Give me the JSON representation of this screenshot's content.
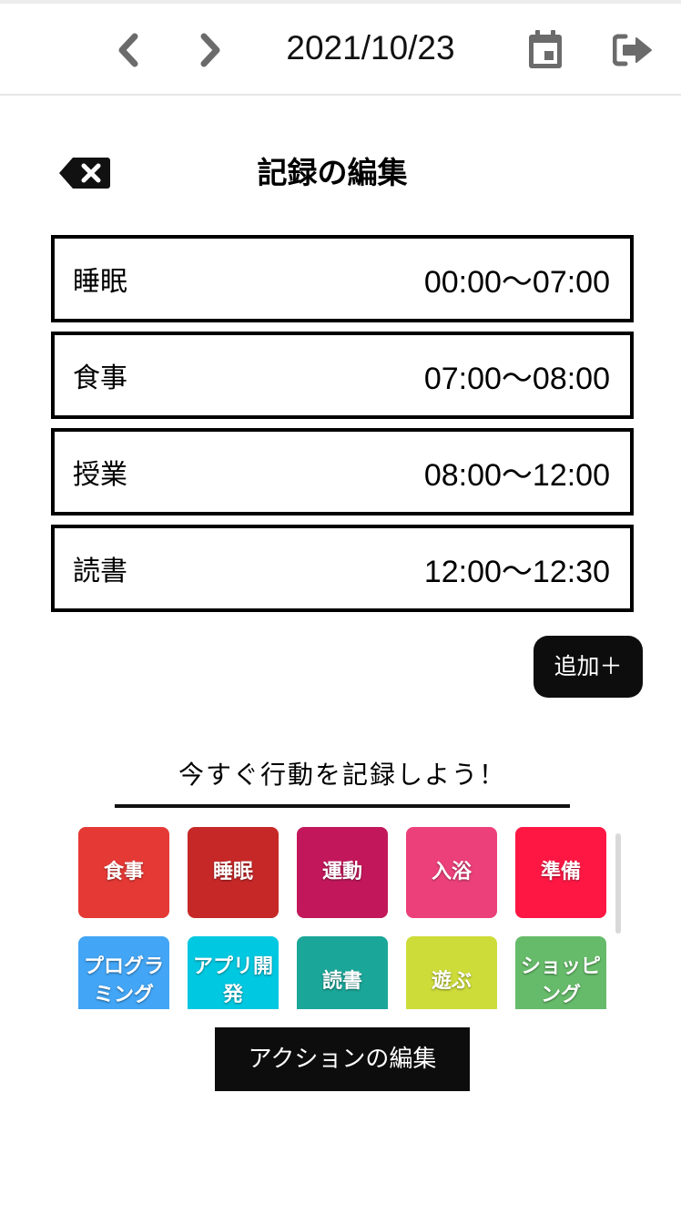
{
  "header": {
    "date": "2021/10/23",
    "prev_icon": "chevron-left-icon",
    "next_icon": "chevron-right-icon",
    "calendar_icon": "calendar-icon",
    "logout_icon": "logout-icon",
    "icon_color": "#6b6b6b"
  },
  "editor": {
    "title": "記録の編集",
    "back_icon": "backspace-icon"
  },
  "records": [
    {
      "name": "睡眠",
      "time": "00:00〜07:00"
    },
    {
      "name": "食事",
      "time": "07:00〜08:00"
    },
    {
      "name": "授業",
      "time": "08:00〜12:00"
    },
    {
      "name": "読書",
      "time": "12:00〜12:30"
    }
  ],
  "add_button": "追加＋",
  "quick": {
    "heading": "今すぐ行動を記録しよう！",
    "actions": [
      {
        "label": "食事",
        "color": "#e53935"
      },
      {
        "label": "睡眠",
        "color": "#c62828"
      },
      {
        "label": "運動",
        "color": "#c2185b"
      },
      {
        "label": "入浴",
        "color": "#ec407a"
      },
      {
        "label": "準備",
        "color": "#ff1744"
      },
      {
        "label": "プログラミング",
        "color": "#42a5f5"
      },
      {
        "label": "アプリ開発",
        "color": "#00c8e0"
      },
      {
        "label": "読書",
        "color": "#1aa698"
      },
      {
        "label": "遊ぶ",
        "color": "#cddc39"
      },
      {
        "label": "ショッピング",
        "color": "#66bb6a"
      }
    ]
  },
  "edit_actions_button": "アクションの編集"
}
